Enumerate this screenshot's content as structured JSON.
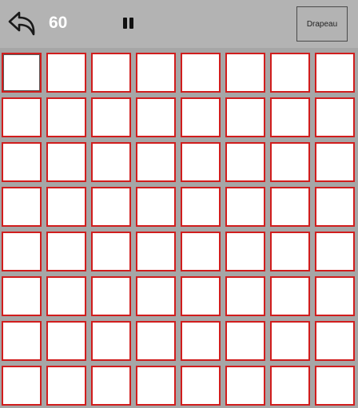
{
  "toolbar": {
    "back_icon": "undo-arrow-icon",
    "counter_value": "60",
    "pause_icon": "pause-icon",
    "flag_button_label": "Drapeau"
  },
  "board": {
    "rows": 8,
    "columns": 8,
    "focused_cell": [
      0,
      0
    ],
    "cell_fill_color": "#ffffff",
    "cell_border_color": "#d11d1d",
    "background_color": "#a6a6a6"
  }
}
